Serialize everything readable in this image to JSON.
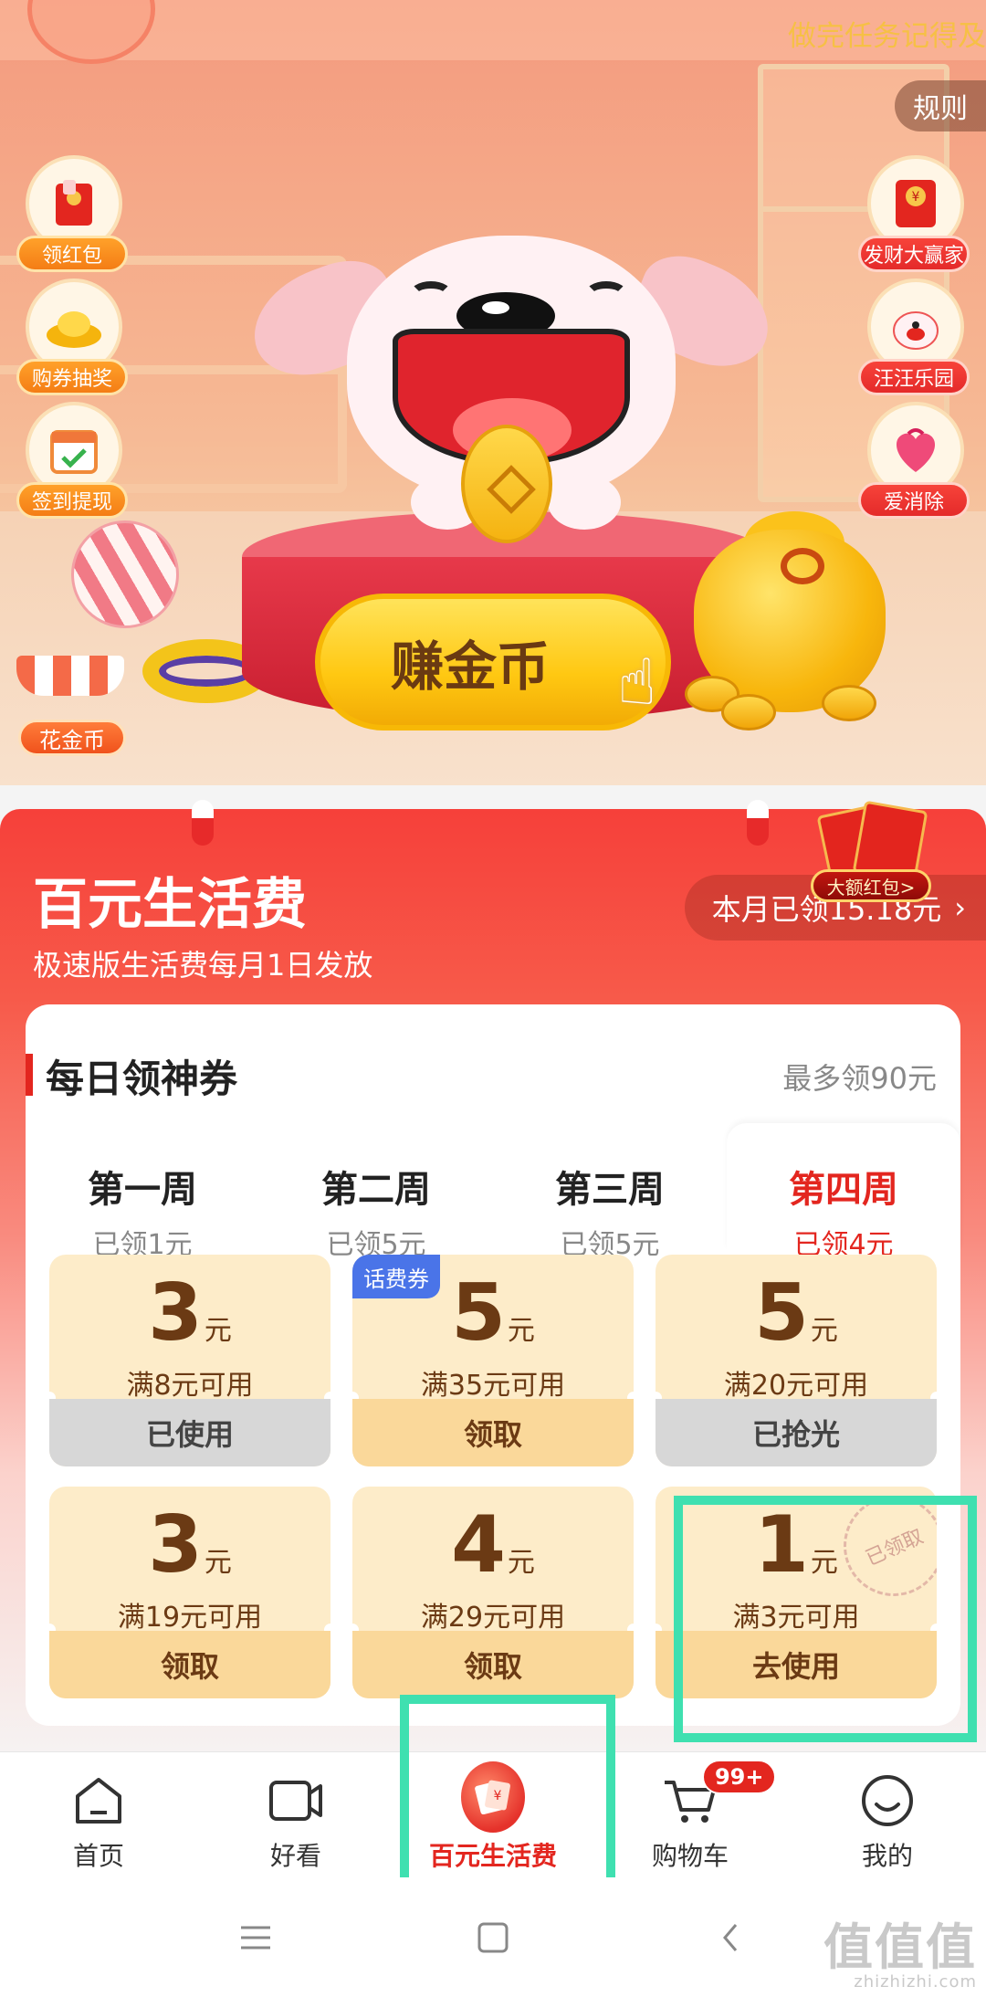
{
  "hero": {
    "marquee": "做完任务记得及",
    "rules_label": "规则",
    "left_icons": [
      {
        "label": "领红包",
        "icon": "red-packet-icon"
      },
      {
        "label": "购券抽奖",
        "icon": "gold-ingot-icon"
      },
      {
        "label": "签到提现",
        "icon": "calendar-check-icon"
      }
    ],
    "right_icons": [
      {
        "label": "发财大赢家",
        "icon": "red-envelope-icon"
      },
      {
        "label": "汪汪乐园",
        "icon": "dog-park-icon"
      },
      {
        "label": "爱消除",
        "icon": "heart-gift-icon"
      }
    ],
    "shop_label": "花金币",
    "earn_button": "赚金币"
  },
  "living": {
    "title": "百元生活费",
    "subtitle": "极速版生活费每月1日发放",
    "claimed": "本月已领15.18元",
    "claimed_arrow": "›",
    "big_redpack": "大额红包>",
    "card": {
      "title": "每日领神券",
      "max": "最多领90元"
    },
    "weeks": [
      {
        "name": "第一周",
        "got": "已领1元"
      },
      {
        "name": "第二周",
        "got": "已领5元"
      },
      {
        "name": "第三周",
        "got": "已领5元"
      },
      {
        "name": "第四周",
        "got": "已领4元"
      }
    ],
    "coupons": [
      {
        "amount": "3",
        "unit": "元",
        "cond": "满8元可用",
        "action": "已使用"
      },
      {
        "amount": "5",
        "unit": "元",
        "cond": "满35元可用",
        "action": "领取",
        "badge": "话费券"
      },
      {
        "amount": "5",
        "unit": "元",
        "cond": "满20元可用",
        "action": "已抢光"
      },
      {
        "amount": "3",
        "unit": "元",
        "cond": "满19元可用",
        "action": "领取"
      },
      {
        "amount": "4",
        "unit": "元",
        "cond": "满29元可用",
        "action": "领取"
      },
      {
        "amount": "1",
        "unit": "元",
        "cond": "满3元可用",
        "action": "去使用",
        "stamp": "已领取"
      }
    ]
  },
  "tabbar": {
    "items": [
      {
        "label": "首页",
        "icon": "home-icon"
      },
      {
        "label": "好看",
        "icon": "video-icon"
      },
      {
        "label": "百元生活费",
        "icon": "living-fee-icon"
      },
      {
        "label": "购物车",
        "icon": "cart-icon"
      },
      {
        "label": "我的",
        "icon": "profile-icon"
      }
    ],
    "cart_badge": "99+"
  },
  "watermark": {
    "text": "值值值",
    "sub": "zhizhizhi.com"
  },
  "colors": {
    "accent": "#e3261f",
    "highlight": "#3fe0b0",
    "coupon_bg": "#fdecc9",
    "coupon_text": "#6b3a14"
  }
}
